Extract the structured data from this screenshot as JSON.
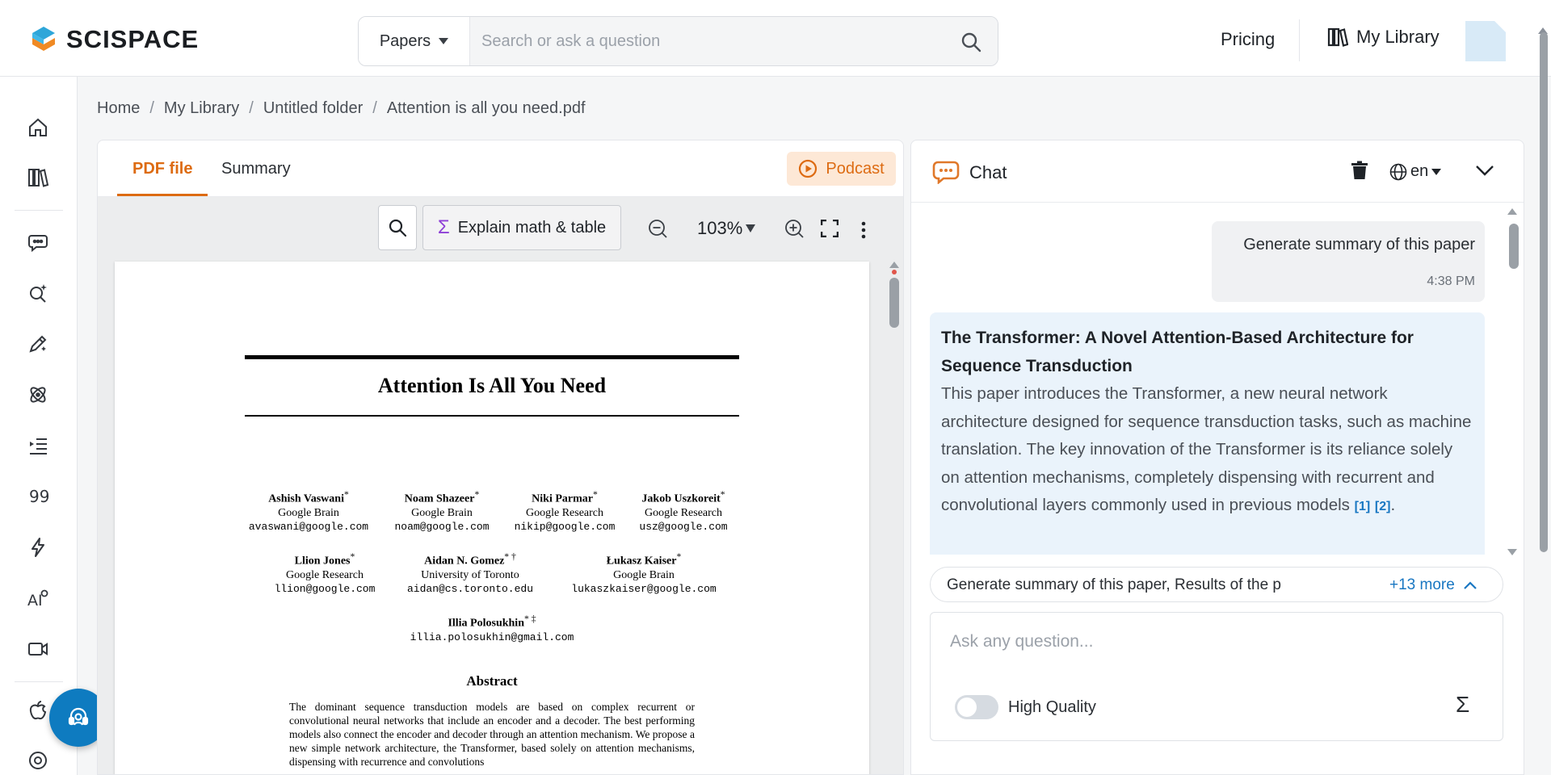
{
  "app": {
    "brand": "SCISPACE",
    "search": {
      "type_label": "Papers",
      "placeholder": "Search or ask a question"
    },
    "nav": {
      "pricing": "Pricing",
      "my_library": "My Library"
    }
  },
  "sidebar": {
    "items": [
      {
        "icon": "home-icon"
      },
      {
        "icon": "library-icon"
      },
      {
        "icon": "chat-icon"
      },
      {
        "icon": "search-sparkle-icon"
      },
      {
        "icon": "pen-icon"
      },
      {
        "icon": "atom-icon"
      },
      {
        "icon": "outline-icon"
      },
      {
        "icon": "quote-icon"
      },
      {
        "icon": "lightning-icon"
      },
      {
        "icon": "ai-detect-icon"
      },
      {
        "icon": "video-icon"
      },
      {
        "icon": "apple-icon"
      },
      {
        "icon": "chrome-icon"
      }
    ]
  },
  "breadcrumb": [
    "Home",
    "My Library",
    "Untitled folder",
    "Attention is all you need.pdf"
  ],
  "pdf_panel": {
    "tabs": [
      {
        "label": "PDF file",
        "active": true
      },
      {
        "label": "Summary",
        "active": false
      }
    ],
    "podcast_label": "Podcast",
    "explain_label": "Explain math & table",
    "zoom": "103%",
    "paper": {
      "title": "Attention Is All You Need",
      "authors": [
        {
          "name": "Ashish Vaswani",
          "mark": "*",
          "affiliation": "Google Brain",
          "email": "avaswani@google.com"
        },
        {
          "name": "Noam Shazeer",
          "mark": "*",
          "affiliation": "Google Brain",
          "email": "noam@google.com"
        },
        {
          "name": "Niki Parmar",
          "mark": "*",
          "affiliation": "Google Research",
          "email": "nikip@google.com"
        },
        {
          "name": "Jakob Uszkoreit",
          "mark": "*",
          "affiliation": "Google Research",
          "email": "usz@google.com"
        },
        {
          "name": "Llion Jones",
          "mark": "*",
          "affiliation": "Google Research",
          "email": "llion@google.com"
        },
        {
          "name": "Aidan N. Gomez",
          "mark": "* †",
          "affiliation": "University of Toronto",
          "email": "aidan@cs.toronto.edu"
        },
        {
          "name": "Łukasz Kaiser",
          "mark": "*",
          "affiliation": "Google Brain",
          "email": "lukaszkaiser@google.com"
        },
        {
          "name": "Illia Polosukhin",
          "mark": "* ‡",
          "affiliation": "",
          "email": "illia.polosukhin@gmail.com"
        }
      ],
      "abstract_heading": "Abstract",
      "abstract_text": "The dominant sequence transduction models are based on complex recurrent or convolutional neural networks that include an encoder and a decoder. The best performing models also connect the encoder and decoder through an attention mechanism. We propose a new simple network architecture, the Transformer, based solely on attention mechanisms, dispensing with recurrence and convolutions"
    }
  },
  "chat": {
    "title": "Chat",
    "language": "en",
    "messages": {
      "user": {
        "text": "Generate summary of this paper",
        "time": "4:38 PM"
      },
      "assistant": {
        "heading": "The Transformer: A Novel Attention-Based Architecture for Sequence Transduction",
        "body": "This paper introduces the Transformer, a new neural network architecture designed for sequence transduction tasks, such as machine translation. The key innovation of the Transformer is its reliance solely on attention mechanisms, completely dispensing with recurrent and convolutional layers commonly used in previous models",
        "citations": [
          "[1]",
          "[2]"
        ]
      }
    },
    "suggestions": {
      "text": "Generate summary of this paper, Results of the p",
      "more": "+13 more"
    },
    "input": {
      "placeholder": "Ask any question...",
      "value": ""
    },
    "high_quality": {
      "label": "High Quality",
      "enabled": false
    }
  },
  "colors": {
    "accent": "#dd6b12",
    "link": "#1977c2",
    "assistant_bg": "#eaf3fb",
    "fab": "#0e7bc0"
  }
}
